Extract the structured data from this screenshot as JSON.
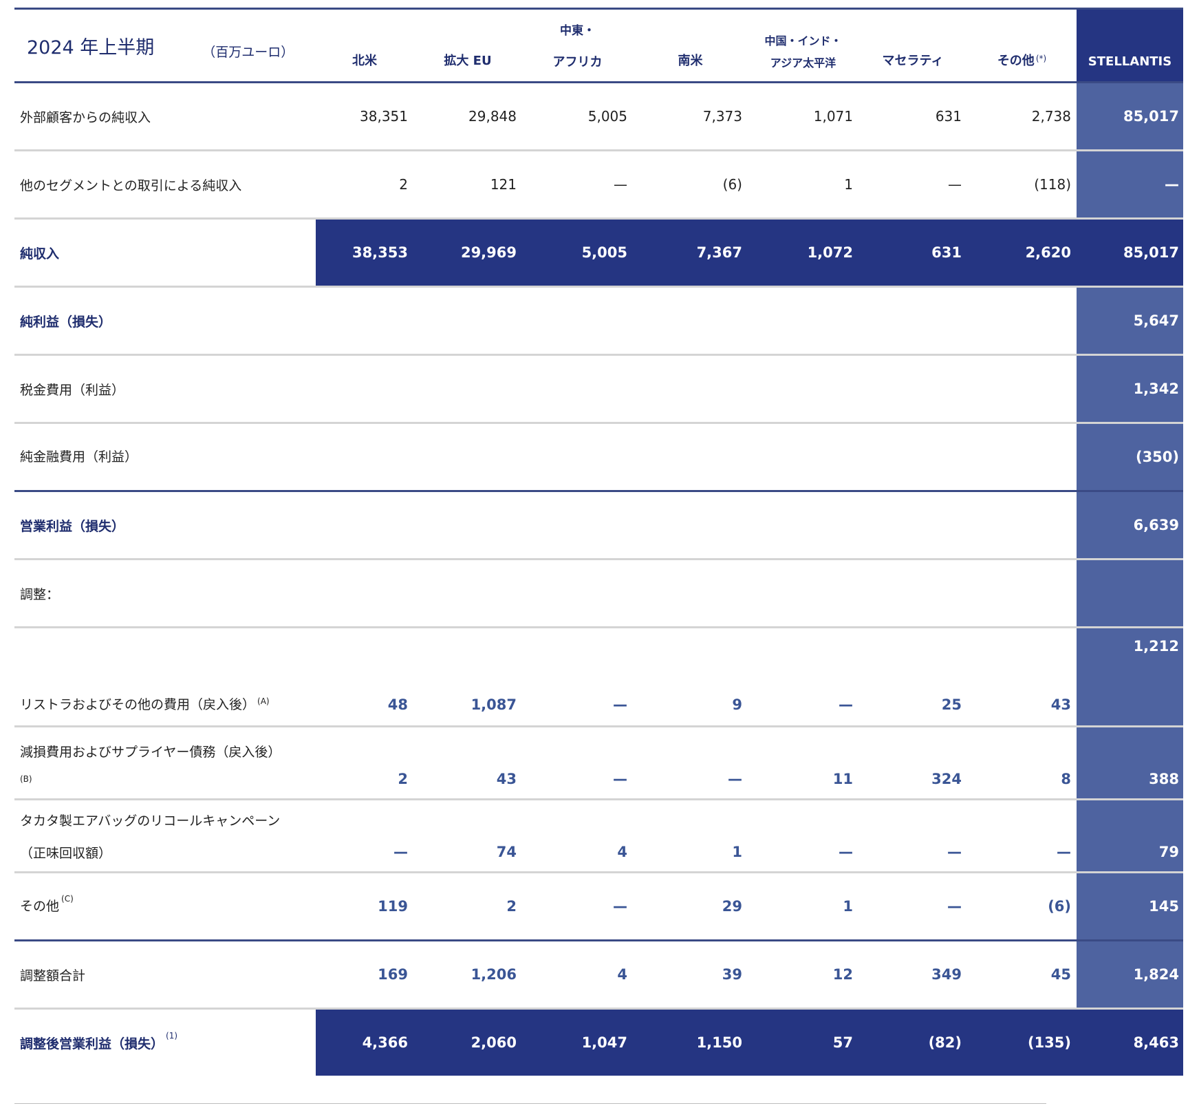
{
  "header": {
    "period": "2024 年上半期",
    "unit": "（百万ユーロ）",
    "columns": {
      "na": "北米",
      "eu": "拡大 EU",
      "mea_top": "中東・",
      "mea_bottom": "アフリカ",
      "sa": "南米",
      "apac_top": "中国・インド・",
      "apac_bottom": "アジア太平洋",
      "maserati": "マセラティ",
      "other": "その他",
      "other_mark": "(*)",
      "stellantis": "STELLANTIS"
    }
  },
  "rows": {
    "ext": {
      "label": "外部顧客からの純収入",
      "v": [
        "38,351",
        "29,848",
        "5,005",
        "7,373",
        "1,071",
        "631",
        "2,738",
        "85,017"
      ]
    },
    "inter": {
      "label": "他のセグメントとの取引による純収入",
      "v": [
        "2",
        "121",
        "—",
        "(6)",
        "1",
        "—",
        "(118)",
        "—"
      ]
    },
    "net": {
      "label": "純収入",
      "v": [
        "38,353",
        "29,969",
        "5,005",
        "7,367",
        "1,072",
        "631",
        "2,620",
        "85,017"
      ]
    },
    "profit": {
      "label": "純利益（損失）",
      "total": "5,647"
    },
    "tax": {
      "label": "税金費用（利益）",
      "total": "1,342"
    },
    "fin": {
      "label": "純金融費用（利益）",
      "total": "(350)"
    },
    "op": {
      "label": "営業利益（損失）",
      "total": "6,639"
    },
    "adj_head": {
      "label": "調整："
    },
    "restr": {
      "label": "リストラおよびその他の費用（戻入後）",
      "note": "(A)",
      "v": [
        "48",
        "1,087",
        "—",
        "9",
        "—",
        "25",
        "43"
      ],
      "total": "1,212"
    },
    "impair": {
      "label": "減損費用およびサプライヤー債務（戻入後）",
      "note": "(B)",
      "v": [
        "2",
        "43",
        "—",
        "—",
        "11",
        "324",
        "8",
        "388"
      ]
    },
    "takata": {
      "label1": "タカタ製エアバッグのリコールキャンペーン",
      "label2": "（正味回収額）",
      "v": [
        "—",
        "74",
        "4",
        "1",
        "—",
        "—",
        "—",
        "79"
      ]
    },
    "other": {
      "label": "その他",
      "note": "(C)",
      "v": [
        "119",
        "2",
        "—",
        "29",
        "1",
        "—",
        "(6)",
        "145"
      ]
    },
    "adj_total": {
      "label": "調整額合計",
      "v": [
        "169",
        "1,206",
        "4",
        "39",
        "12",
        "349",
        "45",
        "1,824"
      ]
    },
    "aoi": {
      "label": "調整後営業利益（損失）",
      "note": "(1)",
      "v": [
        "4,366",
        "2,060",
        "1,047",
        "1,150",
        "57",
        "(82)",
        "(135)",
        "8,463"
      ]
    }
  },
  "colors": {
    "navy": "#253582",
    "stellantis_col": "#4e63a0",
    "adjust_text": "#3a5595"
  }
}
